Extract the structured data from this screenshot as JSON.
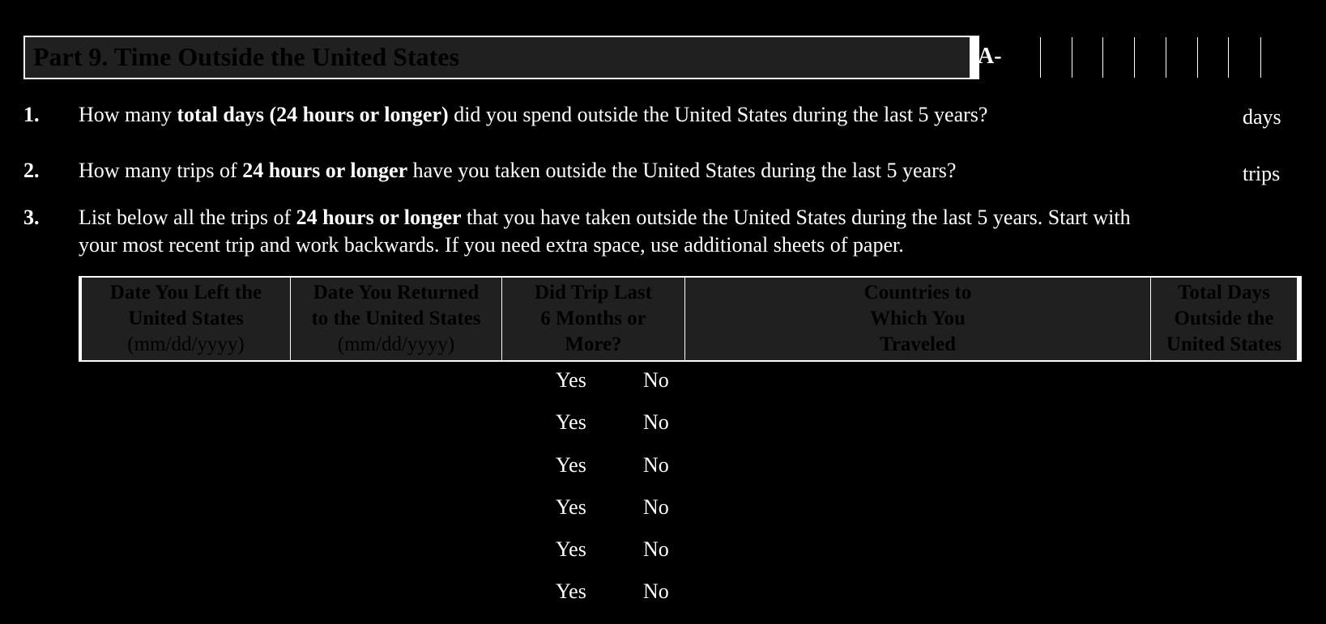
{
  "part": {
    "title": "Part 9.  Time Outside the United States",
    "a_number_prefix": "A-"
  },
  "questions": [
    {
      "number": "1.",
      "pre": "How many ",
      "bold": "total days (24 hours or longer)",
      "post": " did you spend outside the United States during the last 5 years?",
      "unit": "days"
    },
    {
      "number": "2.",
      "pre": "How many trips of ",
      "bold": "24 hours or longer",
      "post": " have you taken outside the United States during the last 5 years?",
      "unit": "trips"
    },
    {
      "number": "3.",
      "pre": "List below all the trips of ",
      "bold": "24 hours or longer",
      "post": " that you have taken outside the United States during the last 5 years.  Start with",
      "line2": "your most recent trip and work backwards.  If you need extra space, use additional sheets of paper."
    }
  ],
  "table": {
    "headers": [
      {
        "lines": [
          "Date You Left the",
          "United States"
        ],
        "sub": "(mm/dd/yyyy)"
      },
      {
        "lines": [
          "Date You Returned",
          "to the United States"
        ],
        "sub": "(mm/dd/yyyy)"
      },
      {
        "lines": [
          "Did Trip Last",
          "6 Months or",
          "More?"
        ]
      },
      {
        "lines": [
          "Countries to",
          "Which You",
          "Traveled"
        ]
      },
      {
        "lines": [
          "Total Days",
          "Outside the",
          "United States"
        ]
      }
    ],
    "rows": [
      {
        "yes": "Yes",
        "no": "No"
      },
      {
        "yes": "Yes",
        "no": "No"
      },
      {
        "yes": "Yes",
        "no": "No"
      },
      {
        "yes": "Yes",
        "no": "No"
      },
      {
        "yes": "Yes",
        "no": "No"
      },
      {
        "yes": "Yes",
        "no": "No"
      }
    ]
  },
  "colors": {
    "background": "#000000",
    "header_fill": "#202020",
    "text": "#ffffff"
  }
}
